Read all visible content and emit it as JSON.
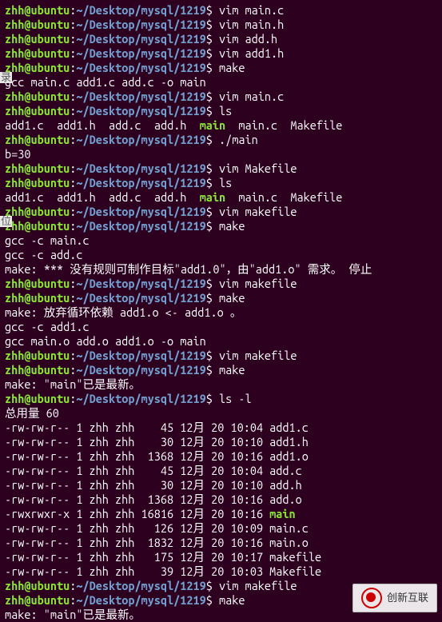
{
  "prompt": {
    "user": "zhh",
    "host": "ubuntu",
    "path": "~/Desktop/mysql/1219"
  },
  "lines": [
    {
      "t": "p",
      "c": "vim main.c"
    },
    {
      "t": "p",
      "c": "vim main.h"
    },
    {
      "t": "p",
      "c": "vim add.h"
    },
    {
      "t": "p",
      "c": "vim add1.h"
    },
    {
      "t": "p",
      "c": "make"
    },
    {
      "t": "o",
      "c": "gcc main.c add1.c add.c -o main"
    },
    {
      "t": "p",
      "c": "vim main.c"
    },
    {
      "t": "p",
      "c": "ls"
    },
    {
      "t": "ls",
      "items": [
        {
          "n": "add1.c",
          "x": false
        },
        {
          "n": "add1.h",
          "x": false
        },
        {
          "n": "add.c",
          "x": false
        },
        {
          "n": "add.h",
          "x": false
        },
        {
          "n": "main",
          "x": true
        },
        {
          "n": "main.c",
          "x": false
        },
        {
          "n": "Makefile",
          "x": false
        }
      ]
    },
    {
      "t": "p",
      "c": "./main"
    },
    {
      "t": "o",
      "c": "b=30"
    },
    {
      "t": "p",
      "c": "vim Makefile"
    },
    {
      "t": "p",
      "c": "ls"
    },
    {
      "t": "ls",
      "items": [
        {
          "n": "add1.c",
          "x": false
        },
        {
          "n": "add1.h",
          "x": false
        },
        {
          "n": "add.c",
          "x": false
        },
        {
          "n": "add.h",
          "x": false
        },
        {
          "n": "main",
          "x": true
        },
        {
          "n": "main.c",
          "x": false
        },
        {
          "n": "Makefile",
          "x": false
        }
      ]
    },
    {
      "t": "p",
      "c": "vim makefile"
    },
    {
      "t": "p",
      "c": "make"
    },
    {
      "t": "o",
      "c": "gcc -c main.c"
    },
    {
      "t": "o",
      "c": "gcc -c add.c"
    },
    {
      "t": "o",
      "c": "make: *** 没有规则可制作目标\"add1.0\"，由\"add1.o\" 需求。 停止"
    },
    {
      "t": "p",
      "c": "vim makefile"
    },
    {
      "t": "p",
      "c": "make"
    },
    {
      "t": "o",
      "c": "make: 放弃循环依赖 add1.o <- add1.o 。"
    },
    {
      "t": "o",
      "c": "gcc -c add1.c"
    },
    {
      "t": "o",
      "c": "gcc main.o add.o add1.o -o main"
    },
    {
      "t": "p",
      "c": "vim makefile"
    },
    {
      "t": "p",
      "c": "make"
    },
    {
      "t": "o",
      "c": "make: \"main\"已是最新。"
    },
    {
      "t": "p",
      "c": "ls -l"
    },
    {
      "t": "o",
      "c": "总用量 60"
    },
    {
      "t": "o",
      "c": "-rw-rw-r-- 1 zhh zhh    45 12月 20 10:04 add1.c"
    },
    {
      "t": "o",
      "c": "-rw-rw-r-- 1 zhh zhh    30 12月 20 10:10 add1.h"
    },
    {
      "t": "o",
      "c": "-rw-rw-r-- 1 zhh zhh  1368 12月 20 10:16 add1.o"
    },
    {
      "t": "o",
      "c": "-rw-rw-r-- 1 zhh zhh    45 12月 20 10:04 add.c"
    },
    {
      "t": "o",
      "c": "-rw-rw-r-- 1 zhh zhh    30 12月 20 10:10 add.h"
    },
    {
      "t": "o",
      "c": "-rw-rw-r-- 1 zhh zhh  1368 12月 20 10:16 add.o"
    },
    {
      "t": "lslong",
      "perm": "-rwxrwxr-x 1 zhh zhh 16816 12月 20 10:16 ",
      "name": "main"
    },
    {
      "t": "o",
      "c": "-rw-rw-r-- 1 zhh zhh   126 12月 20 10:09 main.c"
    },
    {
      "t": "o",
      "c": "-rw-rw-r-- 1 zhh zhh  1832 12月 20 10:16 main.o"
    },
    {
      "t": "o",
      "c": "-rw-rw-r-- 1 zhh zhh   175 12月 20 10:17 makefile"
    },
    {
      "t": "o",
      "c": "-rw-rw-r-- 1 zhh zhh    39 12月 20 10:03 Makefile"
    },
    {
      "t": "p",
      "c": "vim makefile"
    },
    {
      "t": "p",
      "c": "make"
    },
    {
      "t": "o",
      "c": "make: \"main\"已是最新。"
    }
  ],
  "watermark": {
    "text": "创新互联"
  },
  "edge": {
    "a": "录",
    "b": "位"
  }
}
